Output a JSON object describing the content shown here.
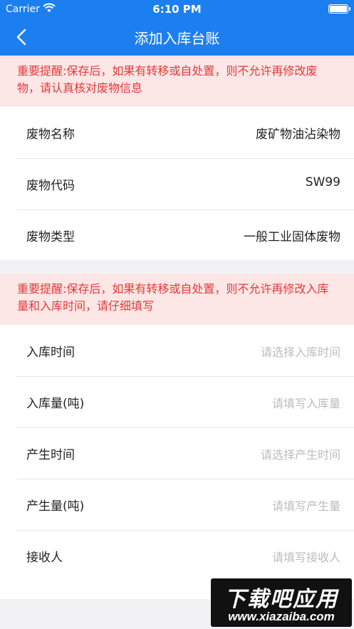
{
  "status_bar": {
    "carrier": "Carrier",
    "time": "6:10 PM"
  },
  "nav": {
    "title": "添加入库台账",
    "back_icon": "chevron-left-icon"
  },
  "alert_waste": {
    "text": "重要提醒:保存后，如果有转移或自处置，则不允许再修改废物，请认真核对废物信息"
  },
  "waste_info": {
    "rows": [
      {
        "label": "废物名称",
        "value": "废矿物油沾染物"
      },
      {
        "label": "废物代码",
        "value": "SW99"
      },
      {
        "label": "废物类型",
        "value": "一般工业固体废物"
      }
    ]
  },
  "alert_storage": {
    "text": "重要提醒:保存后，如果有转移或自处置，则不允许再修改入库量和入库时间，请仔细填写"
  },
  "storage_form": {
    "rows": [
      {
        "label": "入库时间",
        "placeholder": "请选择入库时间"
      },
      {
        "label": "入库量(吨)",
        "placeholder": "请填写入库量"
      },
      {
        "label": "产生时间",
        "placeholder": "请选择产生时间"
      },
      {
        "label": "产生量(吨)",
        "placeholder": "请填写产生量"
      },
      {
        "label": "接收人",
        "placeholder": "请填写接收人"
      }
    ]
  },
  "watermark": {
    "title": "下载吧应用",
    "url": "www.xiazaiba.com"
  },
  "colors": {
    "primary": "#1c7ff0",
    "alert_bg": "#fde6e6",
    "alert_text": "#e53939"
  }
}
